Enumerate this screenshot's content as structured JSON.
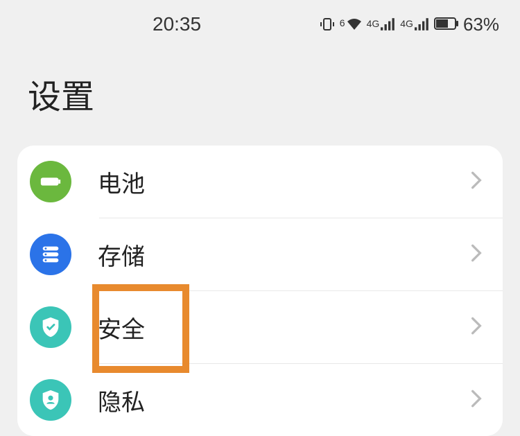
{
  "status_bar": {
    "time": "20:35",
    "battery_percent": "63%",
    "signal_label_1": "4G",
    "signal_label_2": "4G",
    "wifi_label": "6"
  },
  "page": {
    "title": "设置"
  },
  "settings": {
    "items": [
      {
        "label": "电池",
        "icon": "battery"
      },
      {
        "label": "存储",
        "icon": "storage"
      },
      {
        "label": "安全",
        "icon": "security",
        "highlighted": true
      },
      {
        "label": "隐私",
        "icon": "privacy"
      }
    ]
  }
}
